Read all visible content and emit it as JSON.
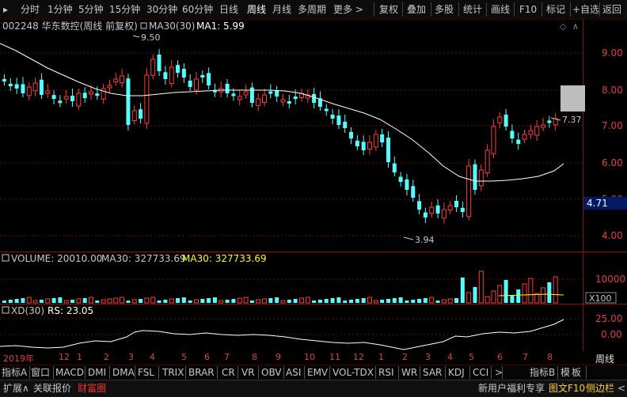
{
  "toolbar": {
    "left_icon": "toolbar-menu-icon",
    "periods": [
      "分时",
      "1分钟",
      "5分钟",
      "15分钟",
      "30分钟",
      "60分钟",
      "日线",
      "周线",
      "月线",
      "多周期",
      "更多 >"
    ],
    "active_period": "周线",
    "actions": [
      "复权",
      "叠加",
      "多股",
      "统计",
      "画线",
      "F10",
      "标记",
      "+自选",
      "返回"
    ]
  },
  "price_panel": {
    "title": "002248 华东数控(周线 前复权)",
    "ma_label": "MA30(30)",
    "ma_value": "MA1: 5.99",
    "y_ticks": [
      "9.00",
      "8.00",
      "7.00",
      "6.00",
      "5.00",
      "4.00"
    ],
    "high_label": "9.50",
    "low_label": "3.94",
    "last_price_label": "7.37",
    "cursor_price_label": "4.71"
  },
  "volume_panel": {
    "label": "VOLUME: 20010.00",
    "ma_a": "MA30: 327733.69",
    "ma_b": "MA30: 327733.69",
    "y_tick": "10000",
    "unit": "X100"
  },
  "xd_panel": {
    "label": "XD(30)",
    "rs": "RS: 23.05",
    "y_ticks": [
      "25.00",
      "0.00"
    ]
  },
  "time_axis": {
    "labels": [
      "2019年",
      "12",
      "1",
      "2",
      "3",
      "4",
      "5",
      "6",
      "7",
      "8",
      "9",
      "10",
      "11",
      "12",
      "1",
      "2",
      "3",
      "4",
      "5",
      "6",
      "7",
      "8"
    ],
    "period_label": "周线"
  },
  "indicator_tabs": [
    "指标A",
    "窗口",
    "MACD",
    "DMI",
    "DMA",
    "FSL",
    "TRIX",
    "BRAR",
    "CR",
    "VR",
    "OBV",
    "ASI",
    "EMV",
    "VOL-TDX",
    "RSI",
    "WR",
    "SAR",
    "KDJ",
    "CCI",
    ">"
  ],
  "indicator_right": [
    "指标B",
    "模",
    "板"
  ],
  "status_bar": {
    "left": [
      "扩展∧",
      "关联报价",
      "财富圈"
    ],
    "right": [
      "新用户福利专享",
      "图文F10",
      "侧边栏",
      "<"
    ]
  },
  "colors": {
    "up": "#ff3c3c",
    "down": "#54ffff",
    "ma": "#ffffff",
    "axis_text": "#e0e0e0",
    "grid_red": "#8a1010",
    "price_tick": "#e04040",
    "highlight": "#c8c8c8"
  }
}
